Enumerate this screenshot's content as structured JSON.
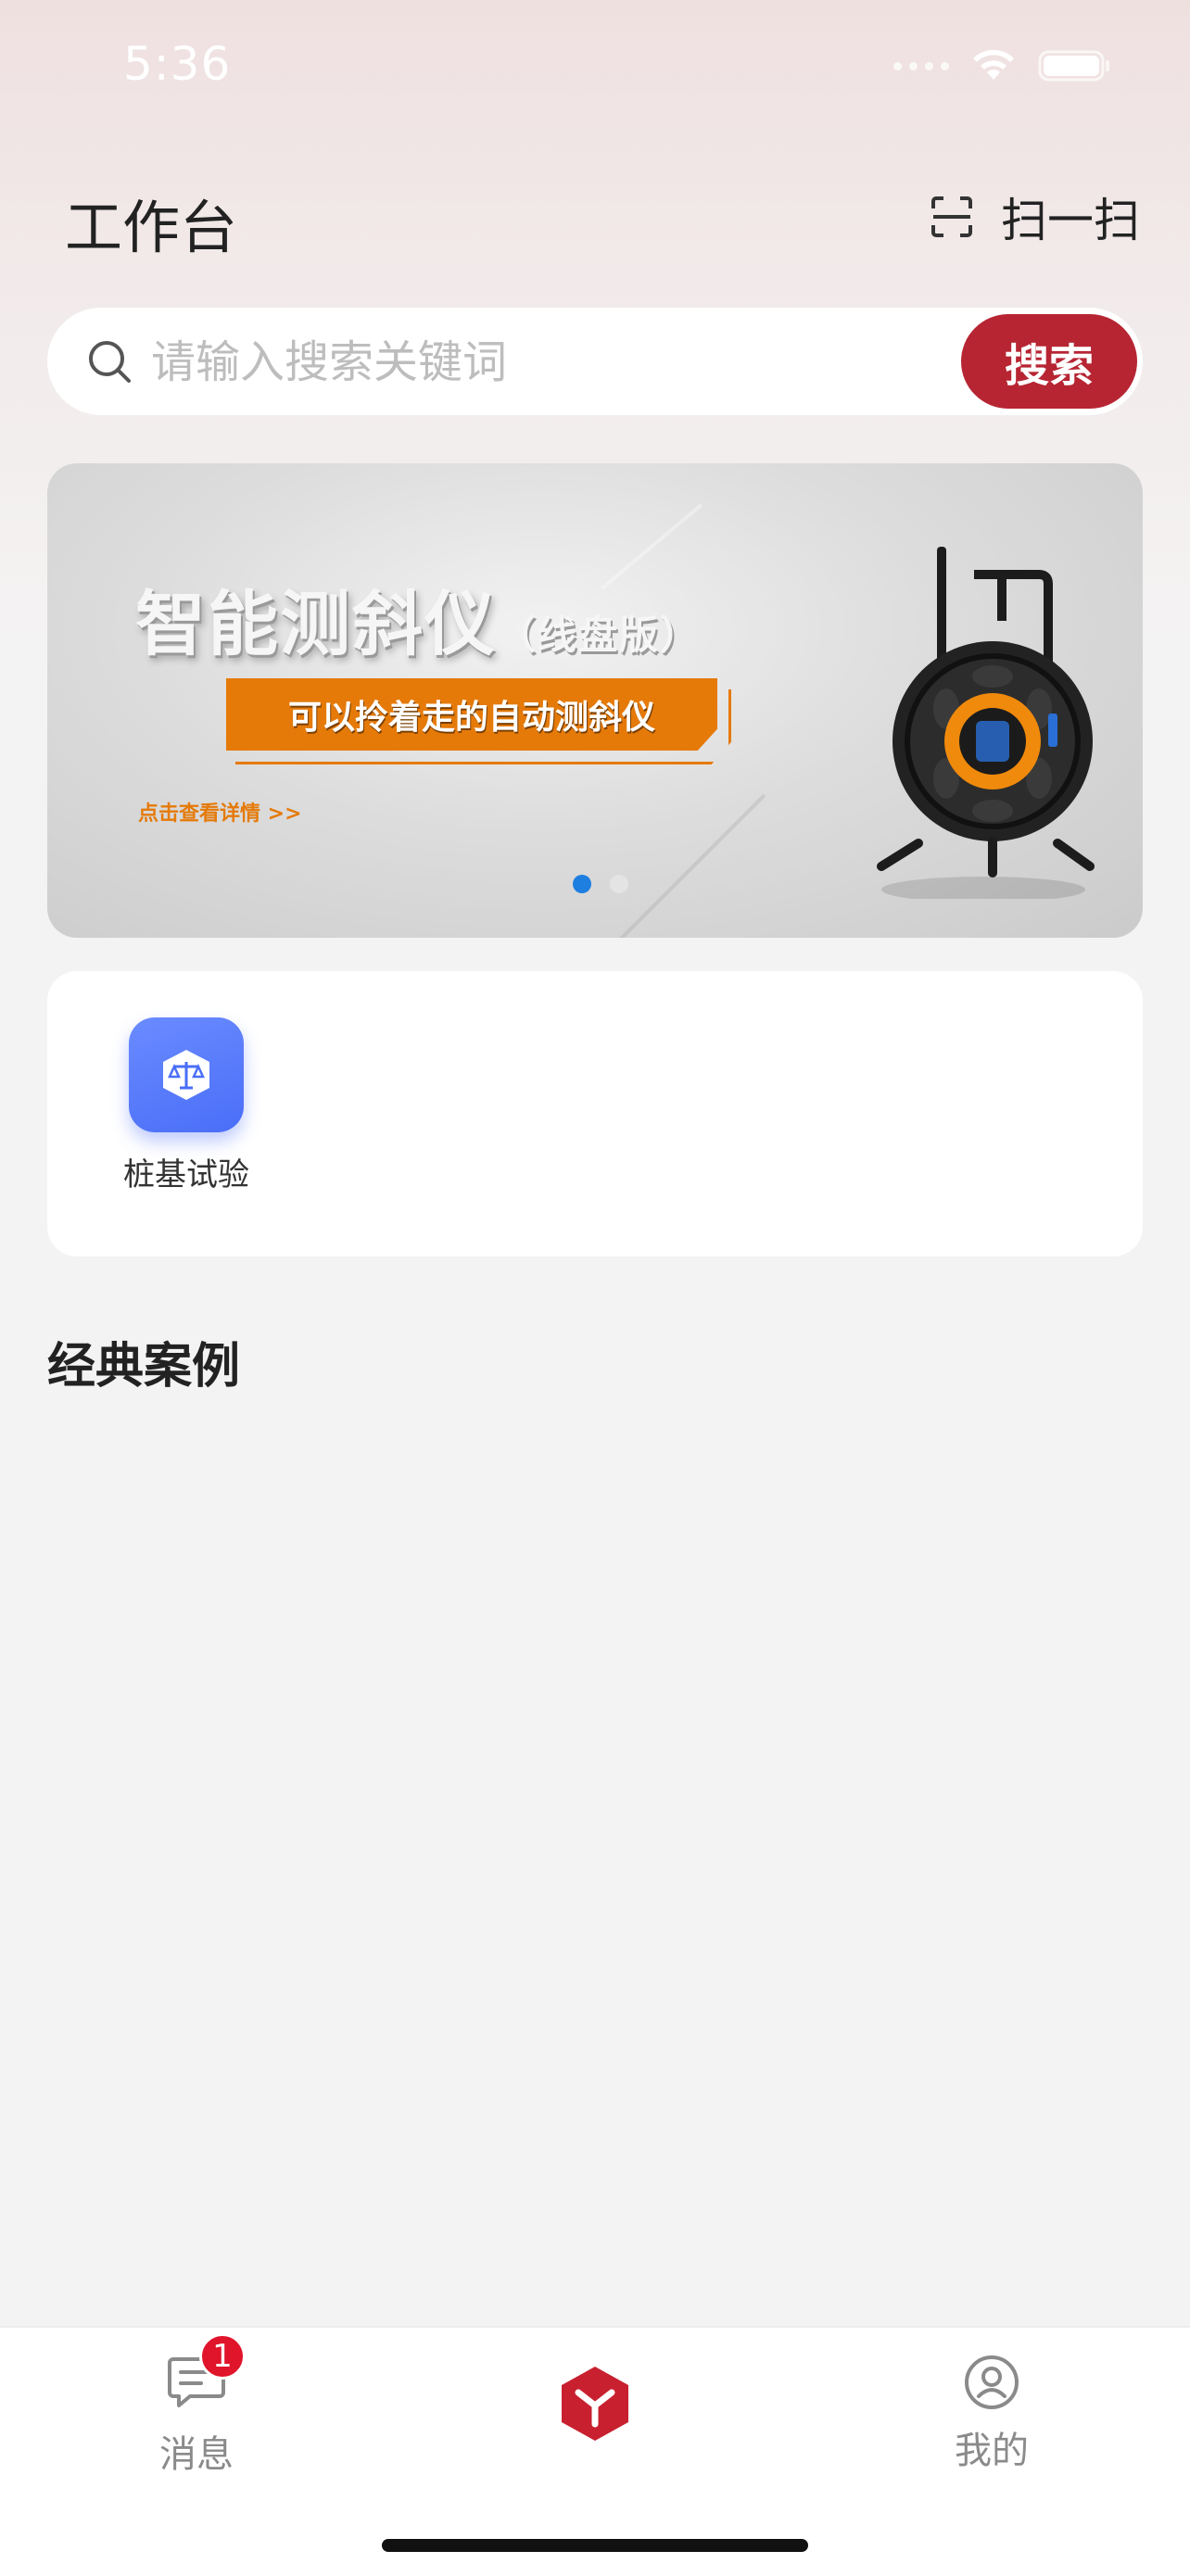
{
  "status_bar": {
    "time": "5:36",
    "wifi_icon": "wifi-icon",
    "battery_icon": "battery-icon"
  },
  "header": {
    "title": "工作台",
    "scan_label": "扫一扫",
    "scan_icon": "scan-icon"
  },
  "search": {
    "placeholder": "请输入搜索关键词",
    "value": "",
    "button_label": "搜索",
    "icon": "search-icon"
  },
  "banner": {
    "title": "智能测斜仪",
    "title_suffix": "（线盘版）",
    "ribbon_text": "可以拎着走的自动测斜仪",
    "link_text": "点击查看详情 >>",
    "slide_count": 2,
    "active_slide": 1,
    "image": "cable-reel-inclinometer-device"
  },
  "apps": [
    {
      "label": "桩基试验",
      "icon": "scale-shield-icon",
      "color": "#4a6ef8"
    }
  ],
  "section": {
    "title": "经典案例"
  },
  "tabbar": {
    "items": [
      {
        "label": "消息",
        "icon": "message-icon",
        "badge": "1"
      },
      {
        "label": "",
        "icon": "home-logo-icon",
        "color": "#c8202f"
      },
      {
        "label": "我的",
        "icon": "profile-icon"
      }
    ]
  },
  "colors": {
    "brand": "#b72533",
    "accent_orange": "#e57a09",
    "badge": "#e0142b",
    "active_dot": "#1f7fe0"
  }
}
